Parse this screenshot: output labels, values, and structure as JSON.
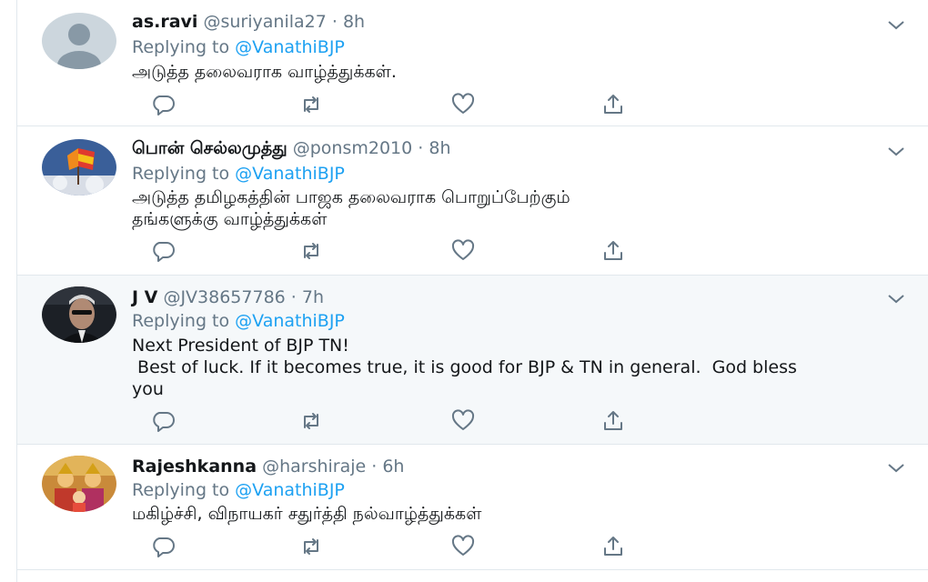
{
  "colors": {
    "link": "#1da1f2",
    "muted": "#657786",
    "text": "#14171a",
    "divider": "#e1e8ed",
    "highlight_bg": "#f5f8fa"
  },
  "tweets": [
    {
      "name": "as.ravi",
      "handle": "@suriyanila27 · 8h",
      "replying_prefix": "Replying to",
      "replying_to": "@VanathiBJP",
      "text": "அடுத்த தலைவராக வாழ்த்துக்கள்.",
      "avatar": "default-avatar"
    },
    {
      "name": "பொன் செல்லமுத்து",
      "handle": "@ponsm2010 · 8h",
      "replying_prefix": "Replying to",
      "replying_to": "@VanathiBJP",
      "text": "அடுத்த தமிழகத்தின் பாஜக தலைவராக பொறுப்பேற்கும்\nதங்களுக்கு வாழ்த்துக்கள்",
      "avatar": "flag-avatar"
    },
    {
      "name": "J V",
      "handle": "@JV38657786 · 7h",
      "replying_prefix": "Replying to",
      "replying_to": "@VanathiBJP",
      "text": "Next President of BJP TN!\n Best of luck. If it becomes true, it is good for BJP & TN in general.  God bless\nyou",
      "avatar": "photo-avatar"
    },
    {
      "name": "Rajeshkanna",
      "handle": "@harshiraje · 6h",
      "replying_prefix": "Replying to",
      "replying_to": "@VanathiBJP",
      "text": "மகிழ்ச்சி, விநாயகர் சதுர்த்தி நல்வாழ்த்துக்கள்",
      "avatar": "deity-avatar"
    }
  ],
  "icons": {
    "reply": "reply-icon",
    "retweet": "retweet-icon",
    "like": "like-icon",
    "share": "share-icon",
    "menu": "chevron-down-icon"
  }
}
